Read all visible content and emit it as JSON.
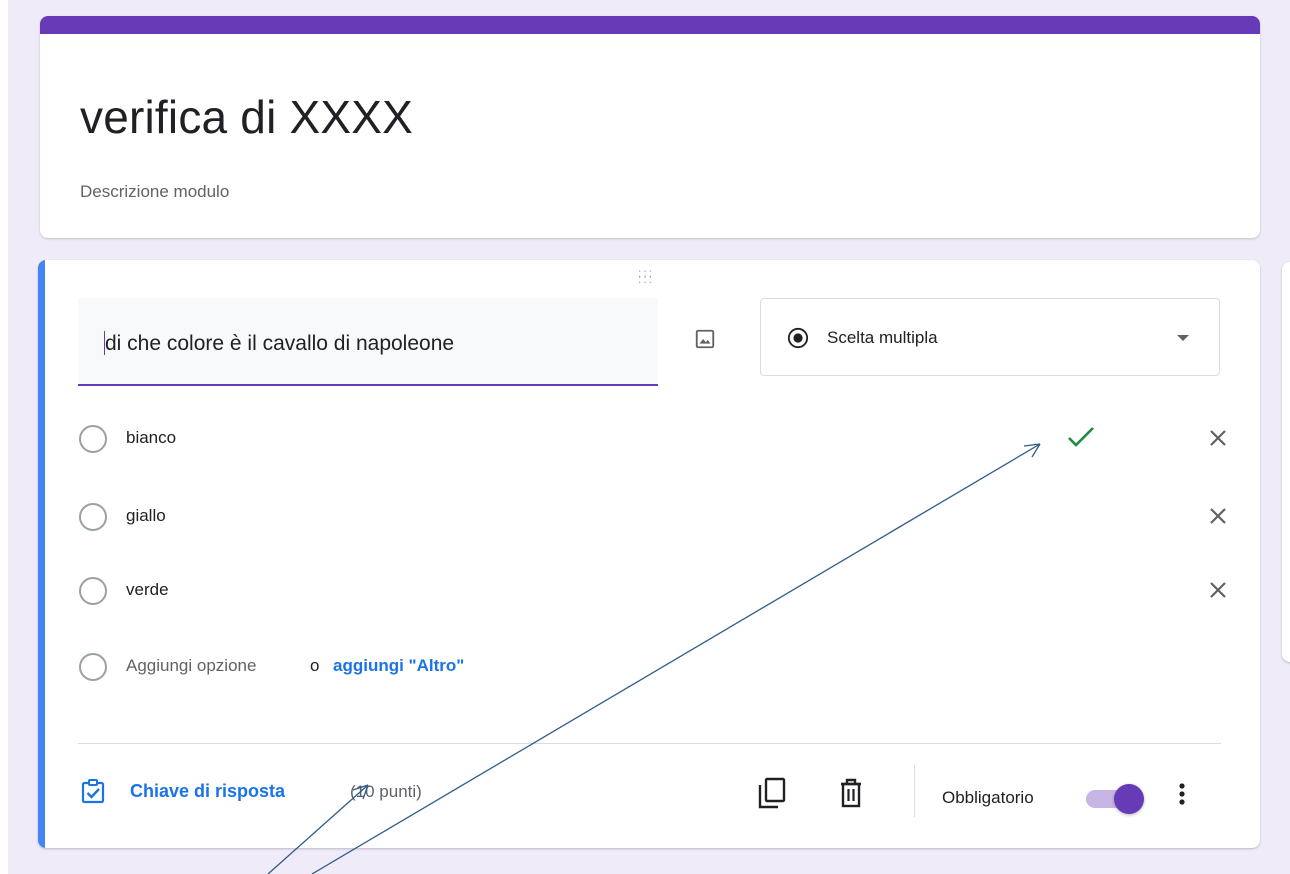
{
  "form": {
    "title": "verifica di XXXX",
    "description_placeholder": "Descrizione modulo",
    "accent_color": "#673ab7"
  },
  "question": {
    "text": "di che colore è il cavallo di napoleone",
    "type_select": {
      "icon": "radio-checked-icon",
      "selected": "Scelta multipla"
    },
    "options": [
      {
        "label": "bianco",
        "correct": true
      },
      {
        "label": "giallo",
        "correct": false
      },
      {
        "label": "verde",
        "correct": false
      }
    ],
    "add_option": {
      "label": "Aggiungi opzione",
      "separator": "o",
      "add_other": "aggiungi \"Altro\""
    }
  },
  "footer": {
    "answer_key_label": "Chiave di risposta",
    "points": "(10 punti)",
    "required_label": "Obbligatorio",
    "required_enabled": true,
    "icons": [
      "copy-icon",
      "trash-icon",
      "more-vert-icon"
    ]
  },
  "colors": {
    "link_blue": "#1a73e8",
    "correct_green": "#1e8e3e",
    "question_accent": "#4285f4",
    "background": "#f0ebf8"
  }
}
